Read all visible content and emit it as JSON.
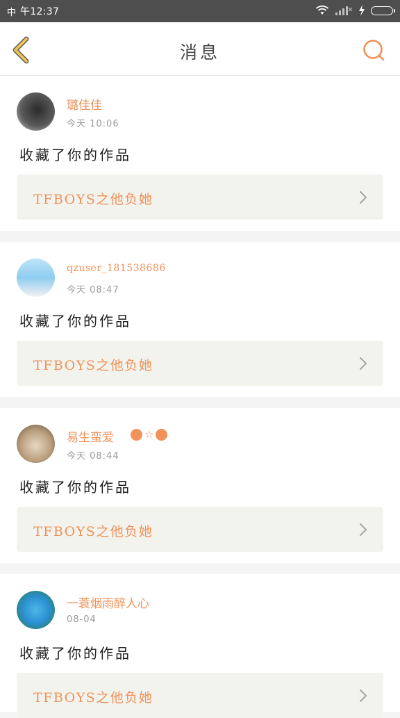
{
  "status_bar": {
    "carrier_icon": "carrier-icon",
    "time": "午12:37",
    "icons": [
      "wifi-icon",
      "signal-icon",
      "charging-icon",
      "battery-icon"
    ]
  },
  "header": {
    "title": "消息",
    "back_icon": "back-chevron-icon",
    "search_icon": "search-icon"
  },
  "colors": {
    "accent": "#f0925a",
    "back_arrow": "#f2c94c",
    "link_bg": "#f3f3ee"
  },
  "messages": [
    {
      "username": "璐佳佳",
      "time": "今天 10:06",
      "action": "收藏了你的作品",
      "work_title": "TFBOYS之他负她"
    },
    {
      "username": "qzuser_181538686",
      "time": "今天 08:47",
      "action": "收藏了你的作品",
      "work_title": "TFBOYS之他负她"
    },
    {
      "username": "易生蛮爱",
      "time": "今天 08:44",
      "action": "收藏了你的作品",
      "work_title": "TFBOYS之他负她",
      "badges": [
        "dot",
        "star",
        "dot"
      ]
    },
    {
      "username": "一蓑烟雨醉人心",
      "time": "08-04",
      "action": "收藏了你的作品",
      "work_title": "TFBOYS之他负她"
    }
  ]
}
